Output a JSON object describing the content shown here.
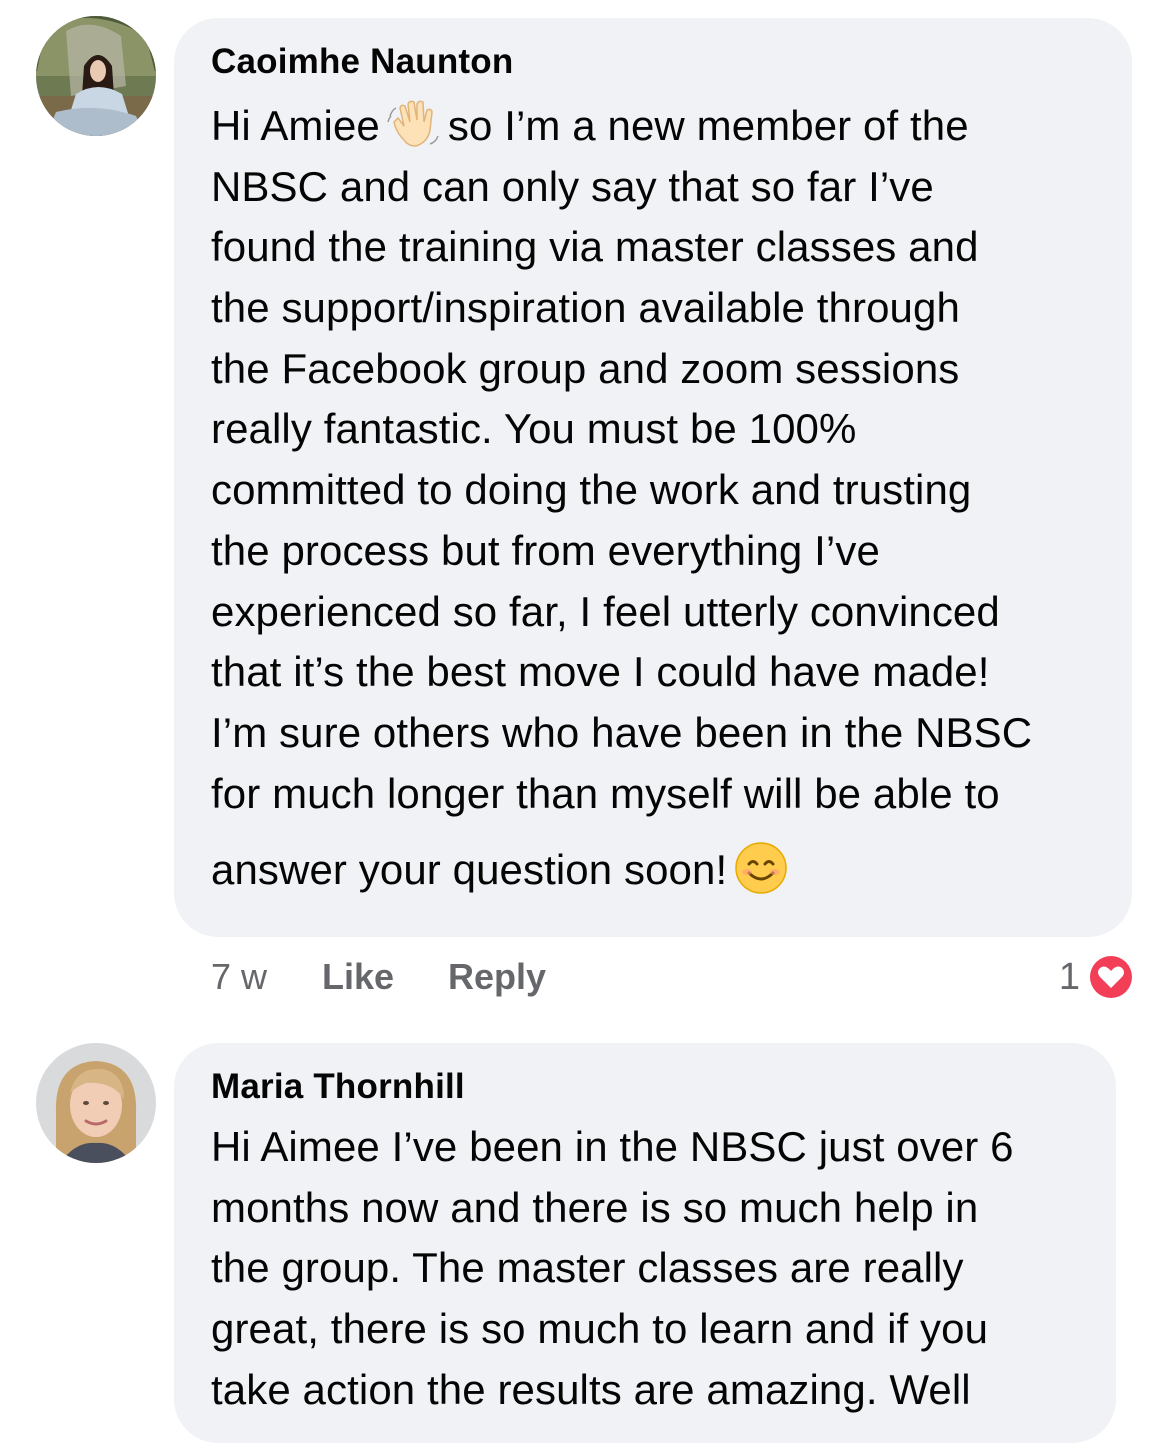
{
  "comments": [
    {
      "author": "Caoimhe Naunton",
      "lines": [
        "Hi Amiee",
        "so I’m a new member of the",
        "NBSC and can only say that so far I’ve",
        "found the training via master classes and",
        "the support/inspiration available through",
        "the Facebook group and zoom sessions",
        "really fantastic. You must be 100%",
        "committed to doing the work and trusting",
        "the process but from everything I’ve",
        "experienced so far, I feel utterly convinced",
        "that it’s the best move I could have made!",
        "I’m sure others who have been in the NBSC",
        "for much longer than myself will be able to",
        "answer your question soon!"
      ],
      "emojis": [
        "waving-hand-emoji",
        "smiling-face-emoji"
      ],
      "time": "7 w",
      "like_label": "Like",
      "reply_label": "Reply",
      "reaction_count": "1",
      "reaction_icon": "heart-icon"
    },
    {
      "author": "Maria Thornhill",
      "lines": [
        "Hi Aimee I’ve been in the NBSC just over 6",
        "months now and there is so much help in",
        "the group. The master classes are really",
        "great, there is so much to learn and if you",
        "take action the results are amazing. Well"
      ]
    }
  ],
  "colors": {
    "bubble": "#f0f2f5",
    "meta_text": "#65676b",
    "heart": "#f33e58"
  }
}
